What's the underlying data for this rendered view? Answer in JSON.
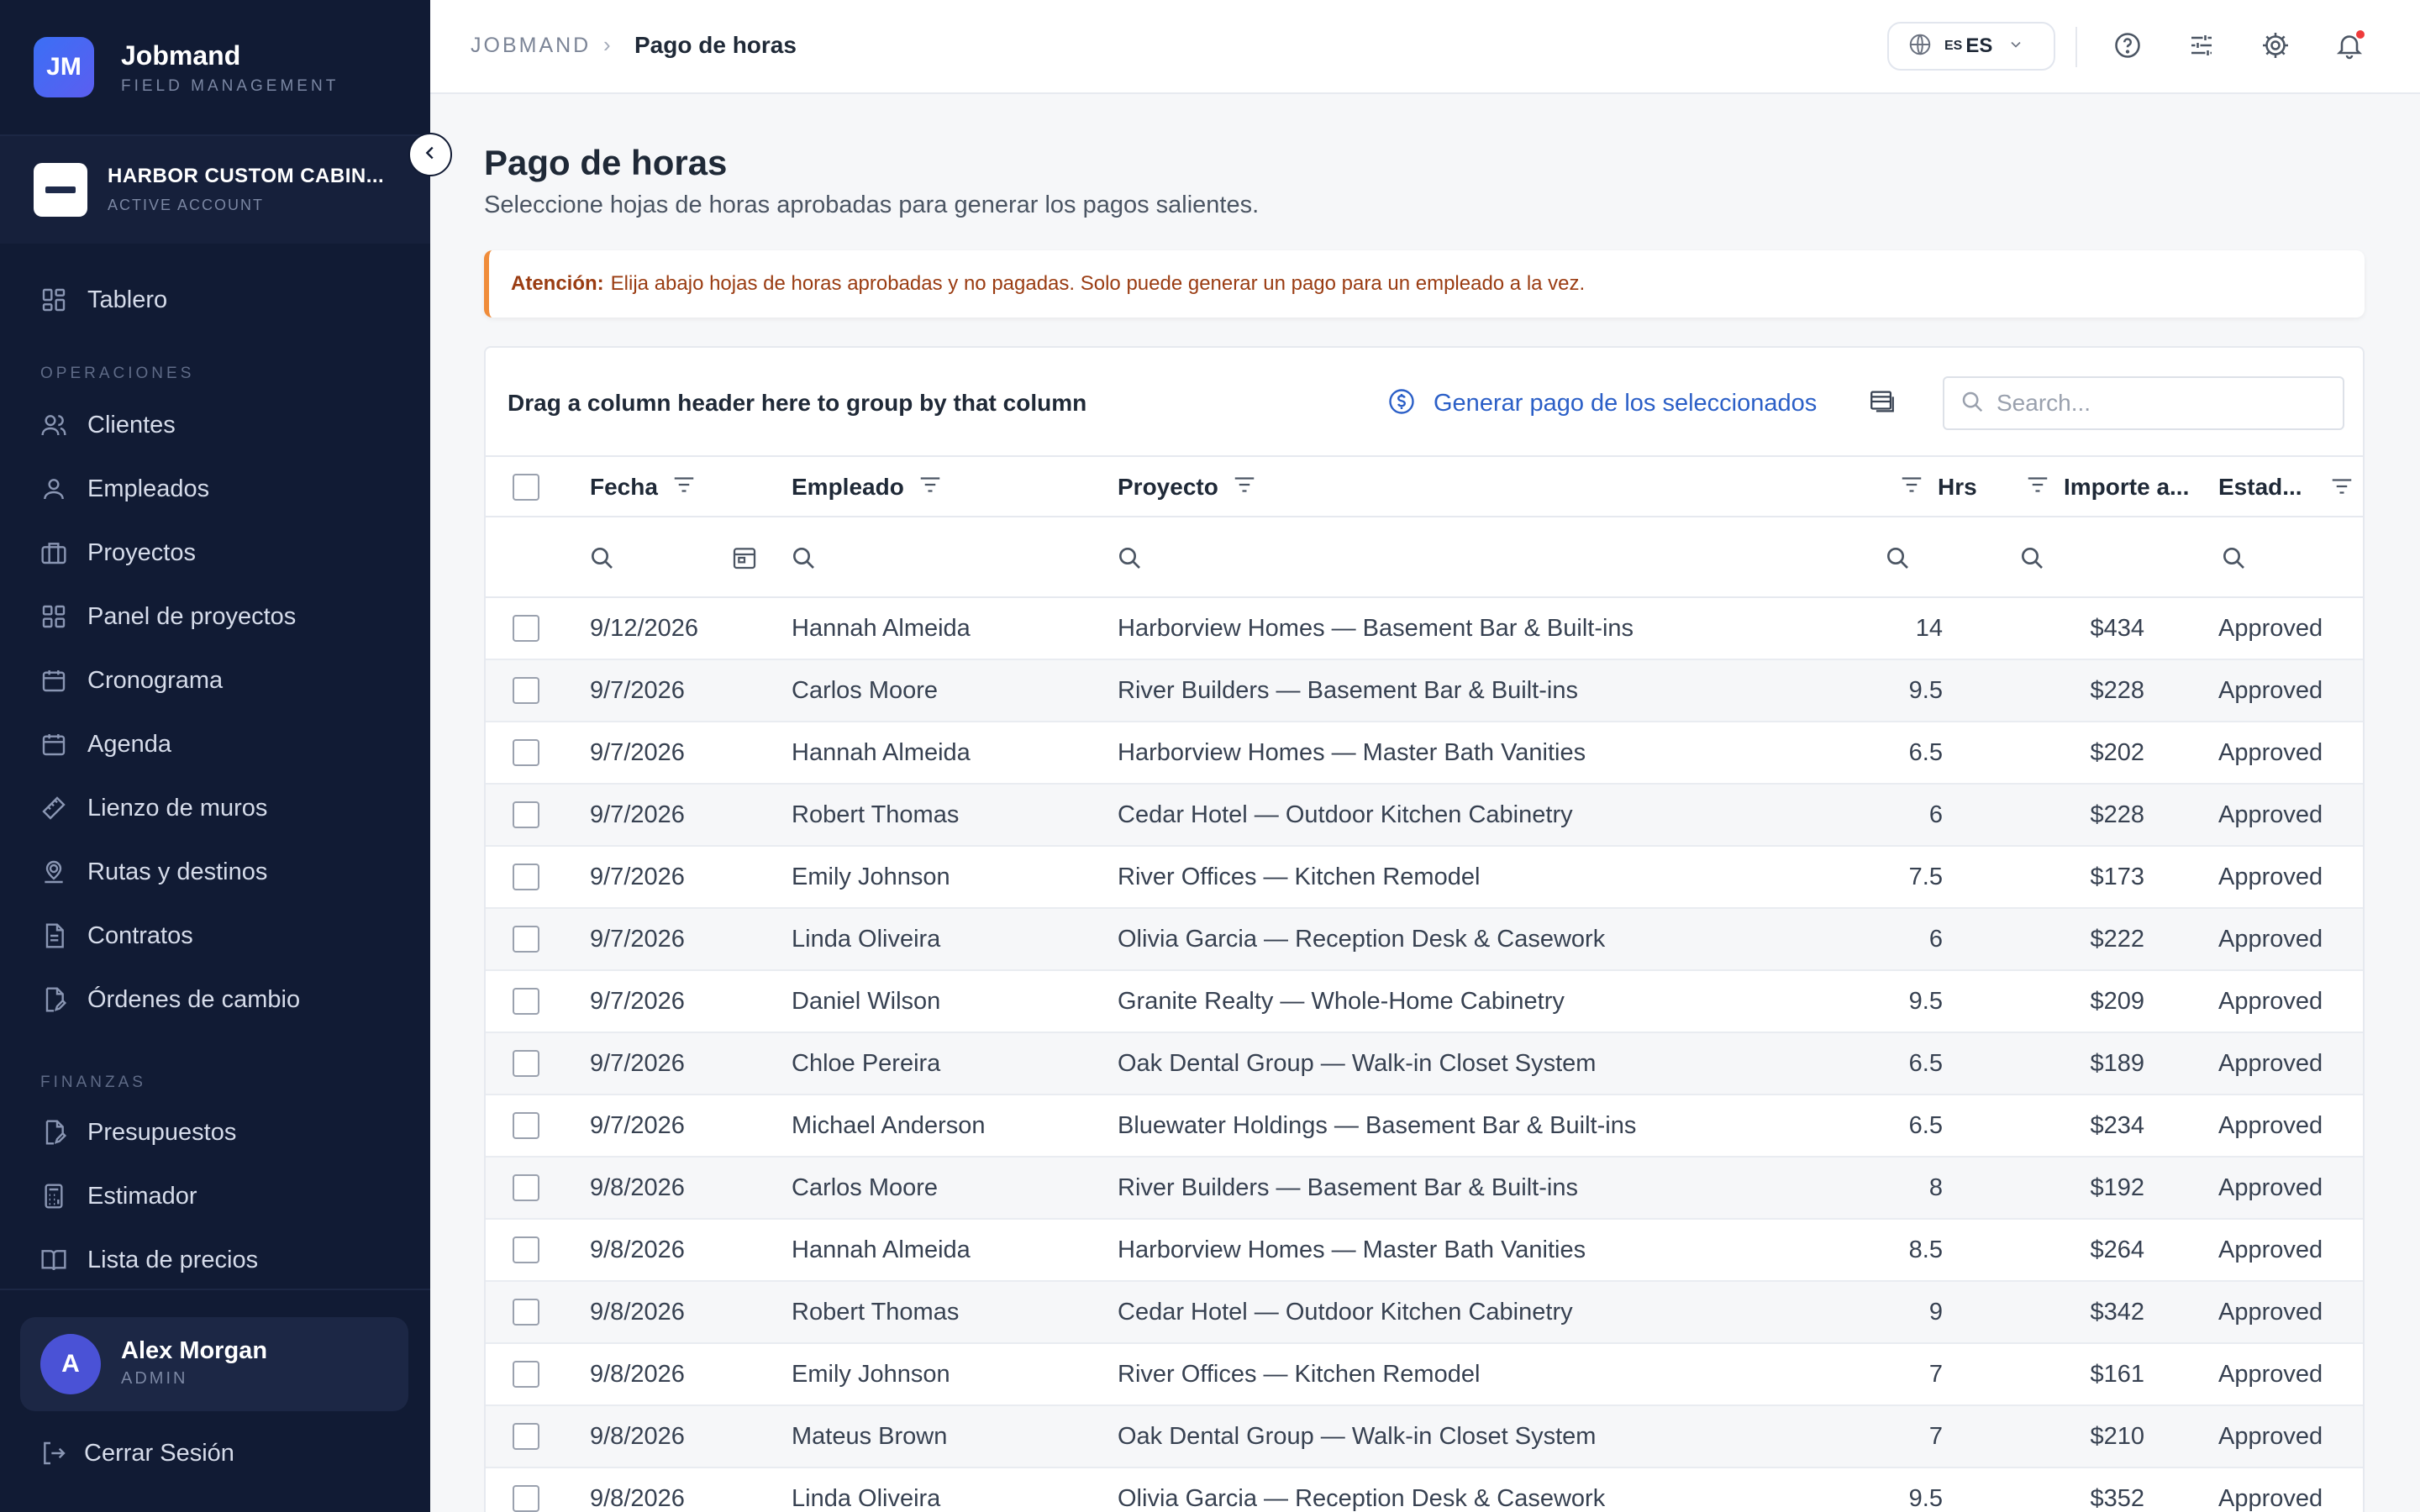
{
  "brand": {
    "initials": "JM",
    "name": "Jobmand",
    "subtitle": "FIELD MANAGEMENT"
  },
  "account": {
    "name": "HARBOR CUSTOM CABIN...",
    "subtitle": "ACTIVE ACCOUNT"
  },
  "nav": {
    "top": [
      {
        "label": "Tablero",
        "icon": "dashboard-icon"
      }
    ],
    "sections": [
      {
        "title": "OPERACIONES",
        "items": [
          {
            "label": "Clientes",
            "icon": "users-icon"
          },
          {
            "label": "Empleados",
            "icon": "user-icon"
          },
          {
            "label": "Proyectos",
            "icon": "briefcase-icon"
          },
          {
            "label": "Panel de proyectos",
            "icon": "grid-icon"
          },
          {
            "label": "Cronograma",
            "icon": "calendar-icon"
          },
          {
            "label": "Agenda",
            "icon": "calendar-icon"
          },
          {
            "label": "Lienzo de muros",
            "icon": "ruler-icon"
          },
          {
            "label": "Rutas y destinos",
            "icon": "map-pin-icon"
          },
          {
            "label": "Contratos",
            "icon": "document-icon"
          },
          {
            "label": "Órdenes de cambio",
            "icon": "document-edit-icon"
          }
        ]
      },
      {
        "title": "FINANZAS",
        "items": [
          {
            "label": "Presupuestos",
            "icon": "document-edit-icon"
          },
          {
            "label": "Estimador",
            "icon": "calculator-icon"
          },
          {
            "label": "Lista de precios",
            "icon": "book-icon"
          }
        ]
      }
    ]
  },
  "user": {
    "initial": "A",
    "name": "Alex Morgan",
    "role": "ADMIN"
  },
  "logout_label": "Cerrar Sesión",
  "breadcrumb": {
    "root": "JOBMAND",
    "separator": "›",
    "current": "Pago de horas"
  },
  "language": {
    "flag": "ES",
    "label": "ES"
  },
  "page": {
    "title": "Pago de horas",
    "subtitle": "Seleccione hojas de horas aprobadas para generar los pagos salientes."
  },
  "alert": {
    "label": "Atención:",
    "text": "Elija abajo hojas de horas aprobadas y no pagadas. Solo puede generar un pago para un empleado a la vez."
  },
  "grid": {
    "group_hint": "Drag a column header here to group by that column",
    "generate_label": "Generar pago de los seleccionados",
    "search_placeholder": "Search...",
    "columns": {
      "fecha": "Fecha",
      "empleado": "Empleado",
      "proyecto": "Proyecto",
      "hrs": "Hrs",
      "importe": "Importe a...",
      "estado": "Estad..."
    },
    "rows": [
      {
        "fecha": "9/12/2026",
        "empleado": "Hannah Almeida",
        "proyecto": "Harborview Homes — Basement Bar & Built-ins",
        "hrs": "14",
        "importe": "$434",
        "estado": "Approved"
      },
      {
        "fecha": "9/7/2026",
        "empleado": "Carlos Moore",
        "proyecto": "River Builders — Basement Bar & Built-ins",
        "hrs": "9.5",
        "importe": "$228",
        "estado": "Approved"
      },
      {
        "fecha": "9/7/2026",
        "empleado": "Hannah Almeida",
        "proyecto": "Harborview Homes — Master Bath Vanities",
        "hrs": "6.5",
        "importe": "$202",
        "estado": "Approved"
      },
      {
        "fecha": "9/7/2026",
        "empleado": "Robert Thomas",
        "proyecto": "Cedar Hotel — Outdoor Kitchen Cabinetry",
        "hrs": "6",
        "importe": "$228",
        "estado": "Approved"
      },
      {
        "fecha": "9/7/2026",
        "empleado": "Emily Johnson",
        "proyecto": "River Offices — Kitchen Remodel",
        "hrs": "7.5",
        "importe": "$173",
        "estado": "Approved"
      },
      {
        "fecha": "9/7/2026",
        "empleado": "Linda Oliveira",
        "proyecto": "Olivia Garcia — Reception Desk & Casework",
        "hrs": "6",
        "importe": "$222",
        "estado": "Approved"
      },
      {
        "fecha": "9/7/2026",
        "empleado": "Daniel Wilson",
        "proyecto": "Granite Realty — Whole-Home Cabinetry",
        "hrs": "9.5",
        "importe": "$209",
        "estado": "Approved"
      },
      {
        "fecha": "9/7/2026",
        "empleado": "Chloe Pereira",
        "proyecto": "Oak Dental Group — Walk-in Closet System",
        "hrs": "6.5",
        "importe": "$189",
        "estado": "Approved"
      },
      {
        "fecha": "9/7/2026",
        "empleado": "Michael Anderson",
        "proyecto": "Bluewater Holdings — Basement Bar & Built-ins",
        "hrs": "6.5",
        "importe": "$234",
        "estado": "Approved"
      },
      {
        "fecha": "9/8/2026",
        "empleado": "Carlos Moore",
        "proyecto": "River Builders — Basement Bar & Built-ins",
        "hrs": "8",
        "importe": "$192",
        "estado": "Approved"
      },
      {
        "fecha": "9/8/2026",
        "empleado": "Hannah Almeida",
        "proyecto": "Harborview Homes — Master Bath Vanities",
        "hrs": "8.5",
        "importe": "$264",
        "estado": "Approved"
      },
      {
        "fecha": "9/8/2026",
        "empleado": "Robert Thomas",
        "proyecto": "Cedar Hotel — Outdoor Kitchen Cabinetry",
        "hrs": "9",
        "importe": "$342",
        "estado": "Approved"
      },
      {
        "fecha": "9/8/2026",
        "empleado": "Emily Johnson",
        "proyecto": "River Offices — Kitchen Remodel",
        "hrs": "7",
        "importe": "$161",
        "estado": "Approved"
      },
      {
        "fecha": "9/8/2026",
        "empleado": "Mateus Brown",
        "proyecto": "Oak Dental Group — Walk-in Closet System",
        "hrs": "7",
        "importe": "$210",
        "estado": "Approved"
      },
      {
        "fecha": "9/8/2026",
        "empleado": "Linda Oliveira",
        "proyecto": "Olivia Garcia — Reception Desk & Casework",
        "hrs": "9.5",
        "importe": "$352",
        "estado": "Approved"
      }
    ]
  },
  "colors": {
    "sidebar": "#111b34",
    "accent": "#2b5fc7",
    "alert": "#f08c3a",
    "notification": "#ef3b3b"
  }
}
